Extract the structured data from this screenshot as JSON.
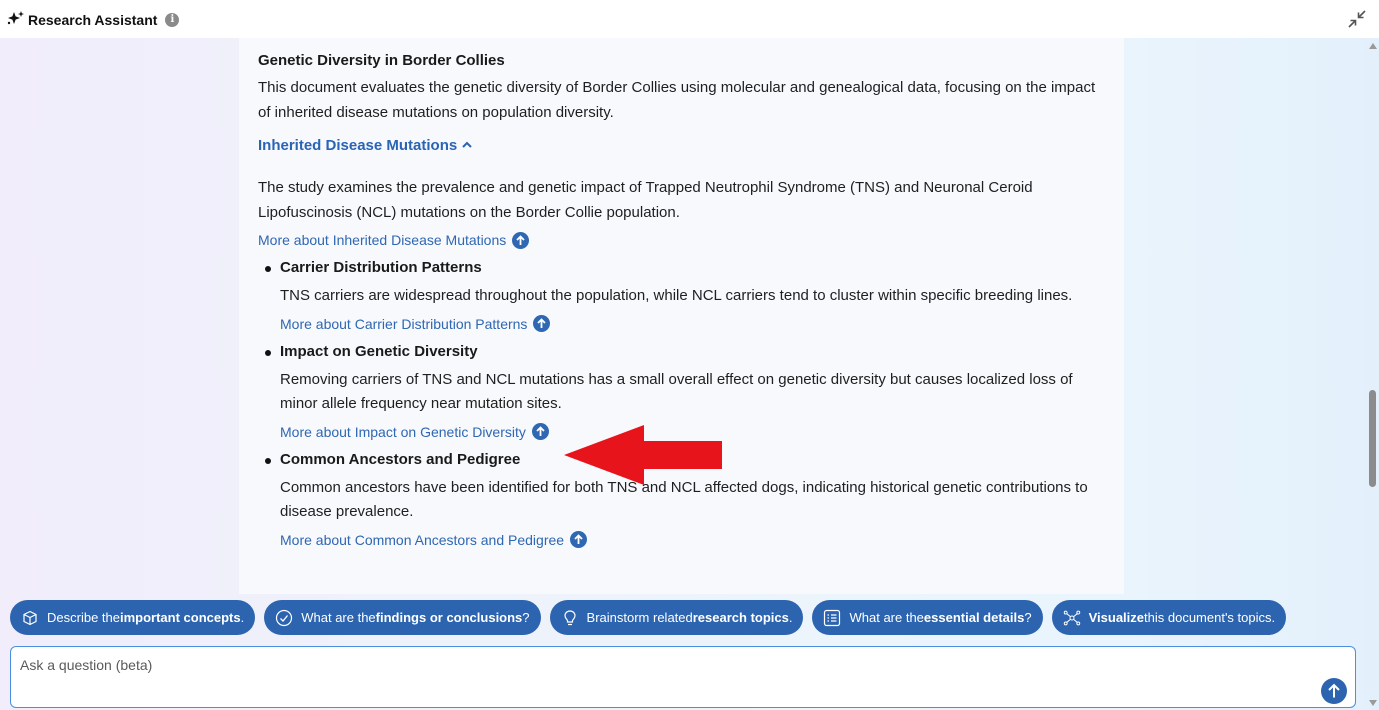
{
  "header": {
    "title": "Research Assistant",
    "info_glyph": "i"
  },
  "document": {
    "title": "Genetic Diversity in Border Collies",
    "summary": "This document evaluates the genetic diversity of Border Collies using molecular and genealogical data, focusing on the impact of inherited disease mutations on population diversity.",
    "section": {
      "title": "Inherited Disease Mutations",
      "description": "The study examines the prevalence and genetic impact of Trapped Neutrophil Syndrome (TNS) and Neuronal Ceroid Lipofuscinosis (NCL) mutations on the Border Collie population.",
      "more_link": "More about Inherited Disease Mutations",
      "subtopics": [
        {
          "title": "Carrier Distribution Patterns",
          "body": "TNS carriers are widespread throughout the population, while NCL carriers tend to cluster within specific breeding lines.",
          "more_link": "More about Carrier Distribution Patterns"
        },
        {
          "title": "Impact on Genetic Diversity",
          "body": "Removing carriers of TNS and NCL mutations has a small overall effect on genetic diversity but causes localized loss of minor allele frequency near mutation sites.",
          "more_link": "More about Impact on Genetic Diversity"
        },
        {
          "title": "Common Ancestors and Pedigree",
          "body": "Common ancestors have been identified for both TNS and NCL affected dogs, indicating historical genetic contributions to disease prevalence.",
          "more_link": "More about Common Ancestors and Pedigree"
        }
      ]
    }
  },
  "chips": [
    {
      "pre": "Describe the ",
      "bold": "important concepts",
      "post": ".",
      "icon": "cube-icon"
    },
    {
      "pre": "What are the ",
      "bold": "findings or conclusions",
      "post": "?",
      "icon": "check-circle-icon"
    },
    {
      "pre": "Brainstorm related ",
      "bold": "research topics",
      "post": ".",
      "icon": "lightbulb-icon"
    },
    {
      "pre": "What are the ",
      "bold": "essential details",
      "post": "?",
      "icon": "list-icon"
    },
    {
      "pre": "",
      "bold": "Visualize",
      "post": " this document's topics.",
      "icon": "network-icon"
    }
  ],
  "ask": {
    "placeholder": "Ask a question (beta)",
    "value": ""
  },
  "colors": {
    "accent": "#2c64b0",
    "link": "#2f67b2",
    "annotation_arrow": "#e8141b"
  }
}
